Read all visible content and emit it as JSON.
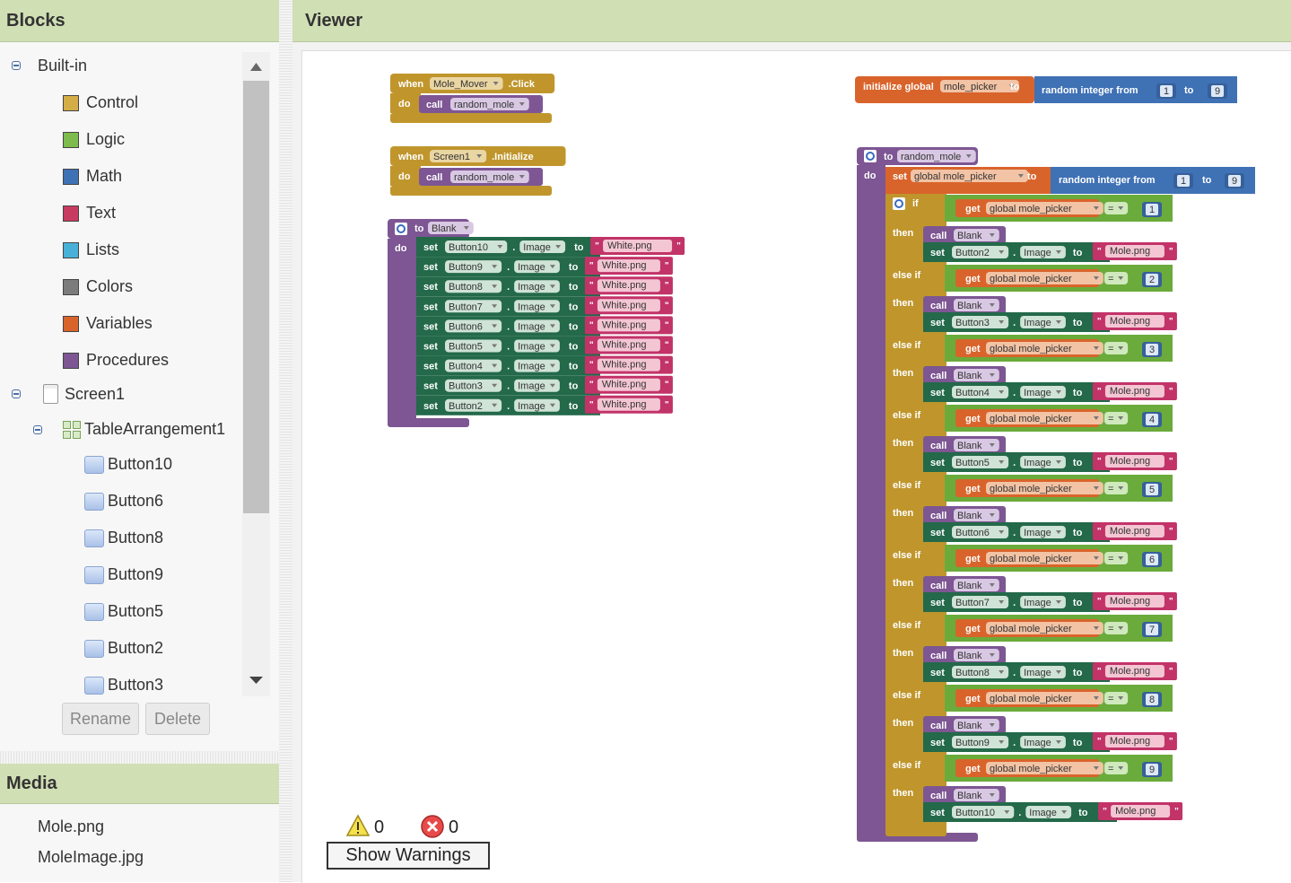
{
  "panels": {
    "blocks_title": "Blocks",
    "viewer_title": "Viewer",
    "media_title": "Media"
  },
  "builtin": {
    "label": "Built-in",
    "items": [
      {
        "label": "Control",
        "color": "#d4ad47"
      },
      {
        "label": "Logic",
        "color": "#7dbb4c"
      },
      {
        "label": "Math",
        "color": "#3f71b5"
      },
      {
        "label": "Text",
        "color": "#c83b60"
      },
      {
        "label": "Lists",
        "color": "#49b1d8"
      },
      {
        "label": "Colors",
        "color": "#7c7c7c"
      },
      {
        "label": "Variables",
        "color": "#d9642b"
      },
      {
        "label": "Procedures",
        "color": "#7d5693"
      }
    ]
  },
  "components": {
    "screen": "Screen1",
    "arrangement": "TableArrangement1",
    "buttons": [
      "Button10",
      "Button6",
      "Button8",
      "Button9",
      "Button5",
      "Button2",
      "Button3"
    ]
  },
  "actions": {
    "rename": "Rename",
    "delete": "Delete"
  },
  "media": [
    "Mole.png",
    "MoleImage.jpg"
  ],
  "warnings": {
    "warning_count": "0",
    "error_count": "0",
    "show_warnings": "Show Warnings"
  },
  "blocks": {
    "w": {
      "when": "when",
      "do": "do",
      "call": "call",
      "set": "set",
      "to": "to",
      "if": "if",
      "then": "then",
      "elseif": "else if",
      "get": "get",
      "image": "Image"
    },
    "event1": {
      "component": "Mole_Mover",
      "event": ".Click",
      "proc": "random_mole"
    },
    "event2": {
      "component": "Screen1",
      "event": ".Initialize",
      "proc": "random_mole"
    },
    "init": {
      "label": "initialize global",
      "name": "mole_picker",
      "to": "to",
      "random": "random integer from",
      "from": "1",
      "upto": "9"
    },
    "blank_proc": {
      "name": "Blank",
      "sets": [
        {
          "btn": "Button10",
          "val": "White.png"
        },
        {
          "btn": "Button9",
          "val": "White.png"
        },
        {
          "btn": "Button8",
          "val": "White.png"
        },
        {
          "btn": "Button7",
          "val": "White.png"
        },
        {
          "btn": "Button6",
          "val": "White.png"
        },
        {
          "btn": "Button5",
          "val": "White.png"
        },
        {
          "btn": "Button4",
          "val": "White.png"
        },
        {
          "btn": "Button3",
          "val": "White.png"
        },
        {
          "btn": "Button2",
          "val": "White.png"
        }
      ]
    },
    "random_mole": {
      "name": "random_mole",
      "setvar": "global mole_picker",
      "random": "random integer from",
      "from": "1",
      "upto": "9",
      "getvar": "global mole_picker",
      "op": "=",
      "blank_call": "Blank",
      "branches": [
        {
          "n": "1",
          "btn": "Button2",
          "val": "Mole.png"
        },
        {
          "n": "2",
          "btn": "Button3",
          "val": "Mole.png"
        },
        {
          "n": "3",
          "btn": "Button4",
          "val": "Mole.png"
        },
        {
          "n": "4",
          "btn": "Button5",
          "val": "Mole.png"
        },
        {
          "n": "5",
          "btn": "Button6",
          "val": "Mole.png"
        },
        {
          "n": "6",
          "btn": "Button7",
          "val": "Mole.png"
        },
        {
          "n": "7",
          "btn": "Button8",
          "val": "Mole.png"
        },
        {
          "n": "8",
          "btn": "Button9",
          "val": "Mole.png"
        },
        {
          "n": "9",
          "btn": "Button10",
          "val": "Mole.png"
        }
      ]
    }
  },
  "colors": {
    "event": "#c0962c",
    "proc": "#7d5693",
    "component": "#23694a",
    "text": "#c23368",
    "logic": "#6aab3b",
    "math": "#3f71b5",
    "variable": "#d9642b"
  }
}
